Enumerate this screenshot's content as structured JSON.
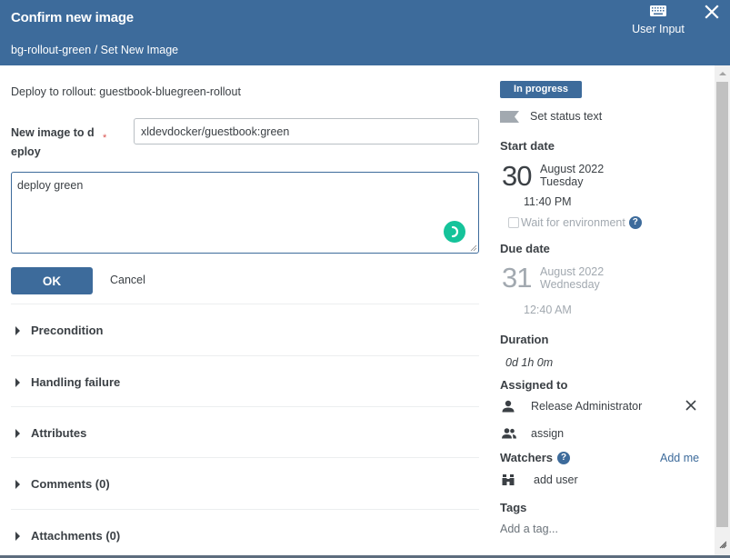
{
  "header": {
    "title": "Confirm new image",
    "breadcrumb": "bg-rollout-green / Set New Image",
    "user_input_label": "User Input",
    "user_input_icon": "keyboard-icon",
    "close_icon": "close-icon"
  },
  "form": {
    "description": "Deploy to rollout: guestbook-bluegreen-rollout",
    "image_field": {
      "label_line1": "New image to d",
      "label_line2": "eploy",
      "required_marker": "*",
      "value": "xldevdocker/guestbook:green"
    },
    "comment_value": "deploy green",
    "ok_label": "OK",
    "cancel_label": "Cancel"
  },
  "sections": [
    {
      "label": "Precondition"
    },
    {
      "label": "Handling failure"
    },
    {
      "label": "Attributes"
    },
    {
      "label": "Comments (0)"
    },
    {
      "label": "Attachments (0)"
    }
  ],
  "sidebar": {
    "status": "In progress",
    "set_status_text": "Set status text",
    "start_date": {
      "heading": "Start date",
      "day": "30",
      "month_year": "August 2022",
      "weekday": "Tuesday",
      "time": "11:40 PM"
    },
    "wait_for_environment": {
      "label": "Wait for environment",
      "checked": false,
      "help": "?"
    },
    "due_date": {
      "heading": "Due date",
      "day": "31",
      "month_year": "August 2022",
      "weekday": "Wednesday",
      "time": "12:40 AM"
    },
    "duration": {
      "heading": "Duration",
      "value": "0d 1h 0m"
    },
    "assigned_to": {
      "heading": "Assigned to",
      "user": "Release Administrator",
      "assign_label": "assign"
    },
    "watchers": {
      "heading": "Watchers",
      "help": "?",
      "add_me": "Add me",
      "add_user": "add user"
    },
    "tags": {
      "heading": "Tags",
      "placeholder": "Add a tag..."
    }
  },
  "colors": {
    "brand": "#3d6b9b",
    "required": "#d9534f",
    "grammarly": "#15c39a"
  }
}
